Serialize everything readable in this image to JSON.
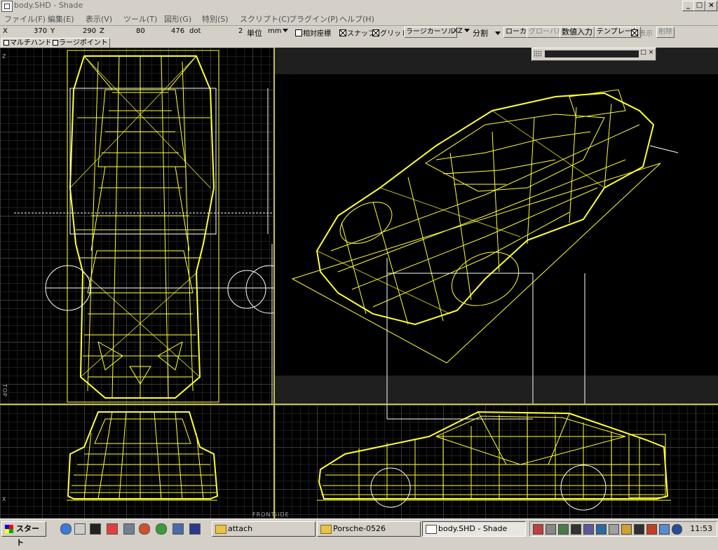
{
  "window": {
    "title": "body.SHD - Shade",
    "buttons": {
      "minimize": "_",
      "maximize": "□",
      "close": "×"
    }
  },
  "menu": [
    "ファイル(F)",
    "編集(E)",
    "表示(V)",
    "ツール(T)",
    "図形(G)",
    "特別(S)",
    "スクリプト(C)",
    "プラグイン(P)",
    "ヘルプ(H)"
  ],
  "toolbar1": {
    "x_label": "X",
    "x_value": "370",
    "y_label": "Y",
    "y_value": "290",
    "z_label": "Z",
    "z_value": "80",
    "dot_value": "476",
    "dot_unit": "dot",
    "step_value": "2",
    "unit_label": "単位",
    "unit_value": "mm",
    "relative_coords": "相対座標",
    "snap": "スナップ",
    "grid": "グリッド",
    "large_cursor": "ラージカーソル",
    "plane": "XZ",
    "split": "分割",
    "local": "ローカル",
    "global": "グローバル",
    "numeric_input": "数値入力",
    "template": "テンプレート",
    "display": "表示",
    "delete": "削除"
  },
  "toolbar2": {
    "multi_handle": "マルチハンドル",
    "large_point": "ラージポイント"
  },
  "viewports": {
    "top_label": "TOP",
    "front_label": "FRONT",
    "side_label": "SIDE",
    "z_axis": "Z",
    "x_axis": "X"
  },
  "colors": {
    "wire": "#ffff33",
    "guide": "#ffffff",
    "grid": "#3a3a3a",
    "viewport_bg": "#000000"
  },
  "taskbar": {
    "start": "スタート",
    "tasks": [
      {
        "label": "attach",
        "icon": "folder-icon",
        "active": false
      },
      {
        "label": "Porsche-0526",
        "icon": "folder-icon",
        "active": false
      },
      {
        "label": "body.SHD - Shade",
        "icon": "shade-app-icon",
        "active": true
      }
    ],
    "clock": "11:53"
  }
}
